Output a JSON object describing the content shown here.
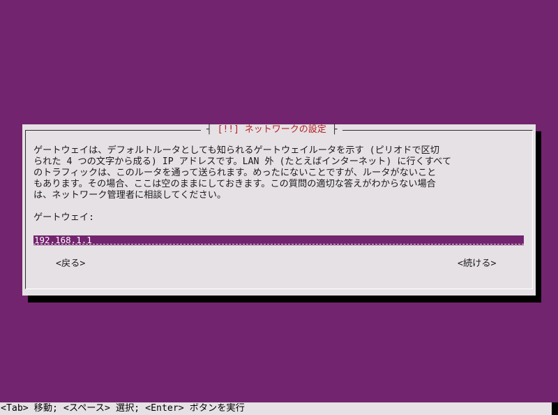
{
  "dialog": {
    "title": "[!!] ネットワークの設定",
    "description": "ゲートウェイは、デフォルトルータとしても知られるゲートウェイルータを示す (ピリオドで区切\nられた 4 つの文字から成る) IP アドレスです。LAN 外 (たとえばインターネット) に行くすべて\nのトラフィックは、このルータを通って送られます。めったにないことですが、ルータがないこと\nもあります。その場合、ここは空のままにしておきます。この質問の適切な答えがわからない場合\nは、ネットワーク管理者に相談してください。",
    "field_label": "ゲートウェイ:",
    "gateway_value": "192.168.1.1",
    "back_label": "<戻る>",
    "continue_label": "<続ける>"
  },
  "statusbar": {
    "text": "<Tab> 移動; <スペース> 選択; <Enter> ボタンを実行"
  },
  "colors": {
    "background": "#73246e",
    "dialog": "#e6e1e5",
    "title": "#b31e20",
    "input": "#73246e"
  }
}
